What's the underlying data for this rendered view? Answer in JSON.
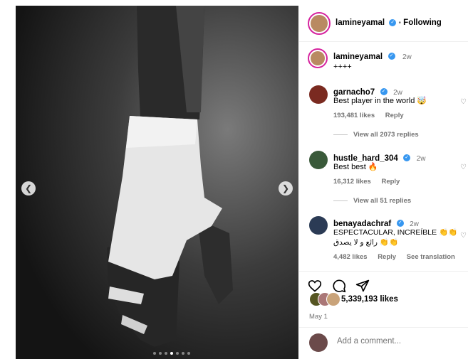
{
  "post": {
    "author": "lamineyamal",
    "follow_status": "Following",
    "separator": "•",
    "caption_time": "2w",
    "caption": "++++",
    "carousel": {
      "count": 7,
      "active": 4
    }
  },
  "comments": [
    {
      "user": "garnacho7",
      "time": "2w",
      "text": "Best player in the world 🤯",
      "likes": "193,481 likes",
      "reply": "Reply",
      "view_replies": "View all 2073 replies"
    },
    {
      "user": "hustle_hard_304",
      "time": "2w",
      "text": "Best best 🔥",
      "likes": "16,312 likes",
      "reply": "Reply",
      "view_replies": "View all 51 replies"
    },
    {
      "user": "benayadachraf",
      "time": "2w",
      "text": "ESPECTACULAR, INCREÍBLE 👏👏",
      "text2": "رائع و لا يصدق 👏👏",
      "likes": "4,482 likes",
      "reply": "Reply",
      "translate": "See translation"
    }
  ],
  "stats": {
    "likes": "5,339,193 likes",
    "date": "May 1"
  },
  "composer": {
    "placeholder": "Add a comment..."
  },
  "icons": {
    "prev": "chevron-left-icon",
    "next": "chevron-right-icon",
    "like": "heart-icon",
    "comment": "comment-icon",
    "share": "send-icon"
  },
  "colors": {
    "verified": "#3797f0",
    "muted": "#737373",
    "story_ring": "#d6249f"
  }
}
